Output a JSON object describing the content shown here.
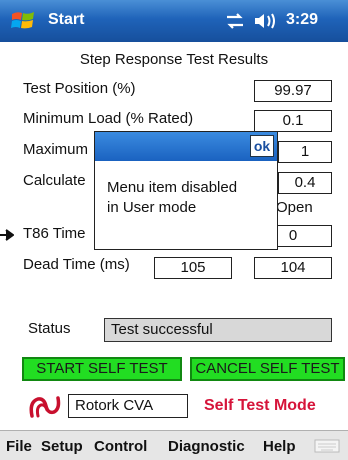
{
  "titlebar": {
    "title": "Start",
    "time": "3:29"
  },
  "heading": "Step Response Test Results",
  "rows": {
    "test_position": {
      "label": "Test Position (%)",
      "value": "99.97"
    },
    "min_load": {
      "label": "Minimum Load (% Rated)",
      "value": "0.1"
    },
    "max_partial": {
      "label": "Maximum",
      "value": "1"
    },
    "calc_partial": {
      "label": "Calculate",
      "value": "0.4",
      "extra": "Open"
    },
    "t86": {
      "label": "T86 Time",
      "value": "0"
    },
    "dead_time": {
      "label": "Dead Time (ms)",
      "value1": "105",
      "value2": "104"
    }
  },
  "dialog": {
    "ok_label": "ok",
    "message": "Menu item disabled\nin User mode"
  },
  "status": {
    "label": "Status",
    "value": "Test successful"
  },
  "buttons": {
    "start": "START SELF TEST",
    "cancel": "CANCEL SELF TEST"
  },
  "footer": {
    "product": "Rotork CVA",
    "mode": "Self Test Mode"
  },
  "menubar": {
    "file": "File",
    "setup": "Setup",
    "control": "Control",
    "diagnostic": "Diagnostic",
    "help": "Help"
  },
  "icons": [
    "windows-flag-icon",
    "connectivity-icon",
    "volume-icon",
    "rotork-logo-icon",
    "keyboard-icon",
    "pointer-arrow-icon"
  ],
  "colors": {
    "titlebar": "#1f63b9",
    "button_green": "#22dd22",
    "mode_red": "#d6143a",
    "status_grey": "#d8d8d8"
  }
}
